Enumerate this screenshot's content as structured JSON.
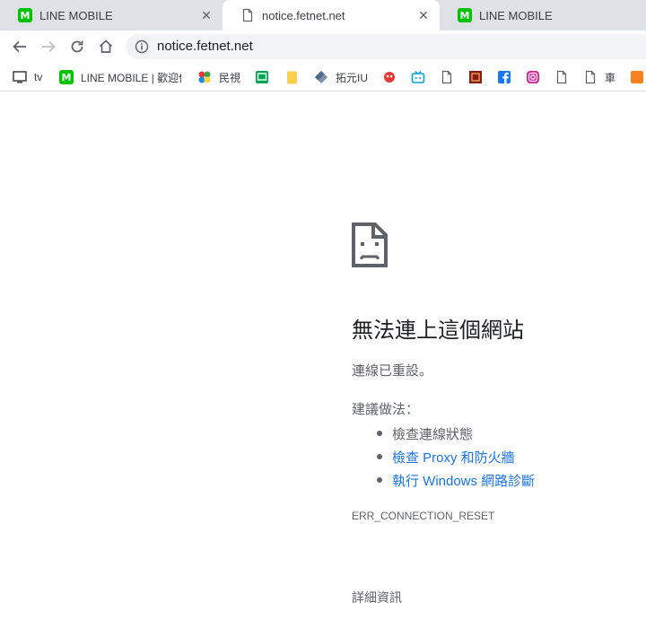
{
  "tabs": [
    {
      "title": "LINE MOBILE",
      "favicon": "line-mobile-icon",
      "active": false
    },
    {
      "title": "notice.fetnet.net",
      "favicon": "document-icon",
      "active": true
    },
    {
      "title": "LINE MOBILE",
      "favicon": "line-mobile-icon",
      "active": false
    }
  ],
  "line_favicon_letter": "M",
  "close_glyph": "✕",
  "address_bar": {
    "url": "notice.fetnet.net"
  },
  "bookmarks": [
    {
      "label": "tv",
      "icon": "monitor-icon"
    },
    {
      "label": "LINE MOBILE | 歡迎使",
      "icon": "line-mobile-icon"
    },
    {
      "label": "民視",
      "icon": "ftv-icon"
    },
    {
      "label": "",
      "icon": "green-tv-icon"
    },
    {
      "label": "",
      "icon": "folder-icon"
    },
    {
      "label": "拓元IU",
      "icon": "tixcraft-icon"
    },
    {
      "label": "",
      "icon": "red-mascot-icon"
    },
    {
      "label": "",
      "icon": "bilibili-icon"
    },
    {
      "label": "",
      "icon": "page-icon"
    },
    {
      "label": "",
      "icon": "red-box-icon"
    },
    {
      "label": "",
      "icon": "facebook-icon"
    },
    {
      "label": "",
      "icon": "instagram-icon"
    },
    {
      "label": "",
      "icon": "page-icon"
    },
    {
      "label": "車",
      "icon": "page-icon"
    },
    {
      "label": "",
      "icon": "orange-badge-icon"
    }
  ],
  "error": {
    "title": "無法連上這個網站",
    "description": "連線已重設。",
    "suggestions_heading": "建議做法：",
    "suggestions": [
      {
        "text": "檢查連線狀態",
        "link": false
      },
      {
        "text": "檢查 Proxy 和防火牆",
        "link": true
      },
      {
        "text": "執行 Windows 網路診斷",
        "link": true
      }
    ],
    "code": "ERR_CONNECTION_RESET",
    "details_label": "詳細資訊"
  },
  "colors": {
    "tab_strip": "#dee1e6",
    "line_green": "#00c300",
    "link": "#1a73e8",
    "text_secondary": "#5f6368",
    "title_text": "#202124"
  }
}
